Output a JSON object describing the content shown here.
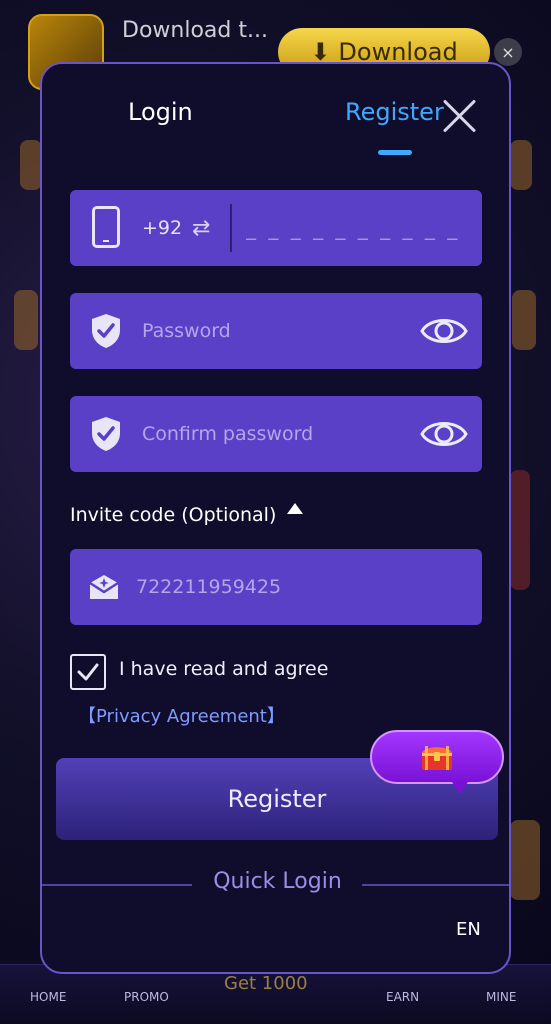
{
  "background": {
    "banner_title": "Download t...",
    "download_button": "Download",
    "close_badge": "×",
    "nav": {
      "home": "HOME",
      "promo": "PROMO",
      "get": "Get 1000",
      "earn": "EARN",
      "mine": "MINE"
    }
  },
  "modal": {
    "tabs": [
      {
        "label": "Login",
        "active": false
      },
      {
        "label": "Register",
        "active": true
      }
    ],
    "accent_color": "#3fa9ff",
    "field_color": "#5a3fc7",
    "phone": {
      "country_code": "+92",
      "swap_icon": "⇄",
      "placeholder": "_ _ _ _ _ _ _ _ _ _",
      "value": ""
    },
    "password": {
      "placeholder": "Password",
      "value": ""
    },
    "confirm_password": {
      "placeholder": "Confirm password",
      "value": ""
    },
    "invite": {
      "label": "Invite code (Optional)",
      "placeholder": "722211959425",
      "value": ""
    },
    "agreement": {
      "checked": true,
      "text": "I have read and agree",
      "link": "【Privacy Agreement】"
    },
    "register_button": "Register",
    "quick_login": "Quick Login",
    "language": "EN"
  }
}
